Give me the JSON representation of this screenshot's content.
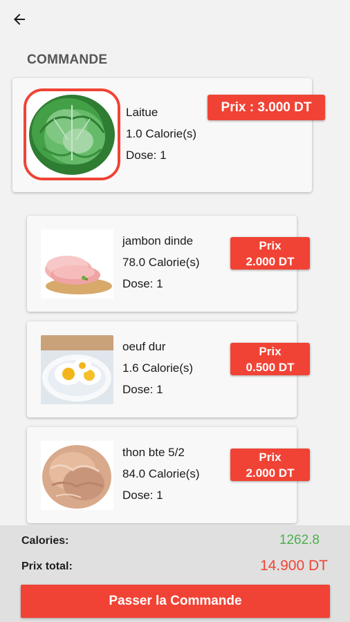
{
  "header": {
    "back_icon": "arrow-left-icon"
  },
  "section": {
    "title": "COMMANDE"
  },
  "main_item": {
    "name": "Laitue",
    "calories": "1.0 Calorie(s)",
    "dose": "Dose: 1",
    "price": "Prix : 3.000 DT",
    "image": "lettuce-image"
  },
  "items": [
    {
      "name": "jambon dinde",
      "calories": "78.0 Calorie(s)",
      "dose": "Dose: 1",
      "price_label": "Prix",
      "price_value": "2.000 DT",
      "image": "ham-slices-image"
    },
    {
      "name": "oeuf dur",
      "calories": "1.6 Calorie(s)",
      "dose": "Dose: 1",
      "price_label": "Prix",
      "price_value": "0.500 DT",
      "image": "boiled-eggs-image"
    },
    {
      "name": "thon bte 5/2",
      "calories": "84.0 Calorie(s)",
      "dose": "Dose: 1",
      "price_label": "Prix",
      "price_value": "2.000 DT",
      "image": "tuna-image"
    }
  ],
  "footer": {
    "calories_label": "Calories:",
    "calories_value": "1262.8",
    "total_label": "Prix total:",
    "total_value": "14.900 DT",
    "order_button": "Passer la Commande"
  },
  "colors": {
    "accent": "#f04335",
    "calories_green": "#4caf50",
    "footer_bg": "#e0e0e0"
  }
}
